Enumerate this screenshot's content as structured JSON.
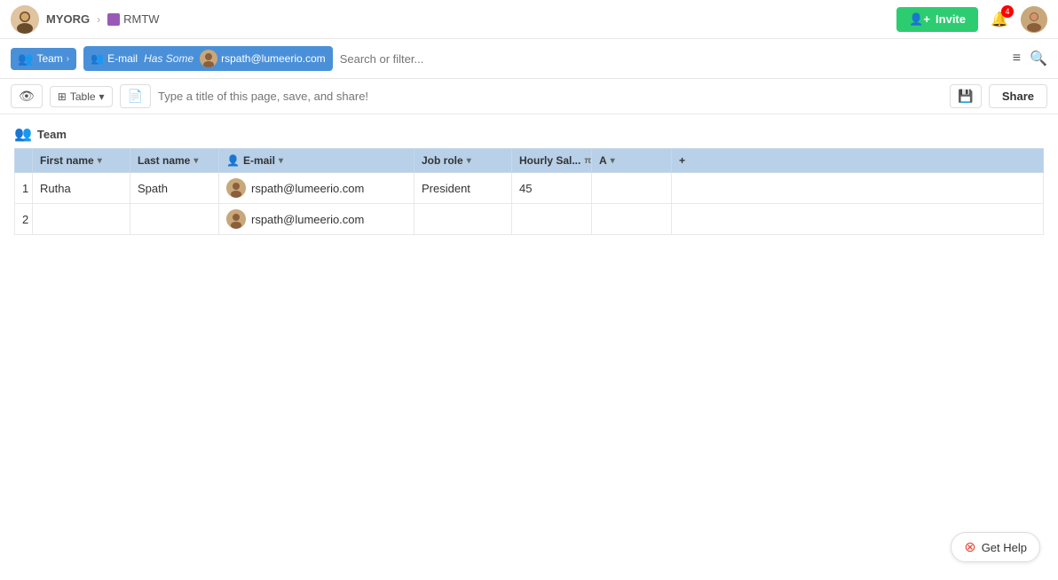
{
  "nav": {
    "org": "MYORG",
    "workspace": "RMTW",
    "invite_label": "Invite",
    "notif_count": "4"
  },
  "filter_bar": {
    "team_label": "Team",
    "email_label": "E-mail",
    "has_some": "Has Some",
    "email_value": "rspath@lumeerio.com",
    "search_placeholder": "Search or filter..."
  },
  "toolbar": {
    "table_label": "Table",
    "page_title_placeholder": "Type a title of this page, save, and share!",
    "share_label": "Share"
  },
  "table": {
    "group_label": "Team",
    "columns": [
      {
        "label": "First name",
        "key": "fn"
      },
      {
        "label": "Last name",
        "key": "ln"
      },
      {
        "label": "E-mail",
        "key": "em"
      },
      {
        "label": "Job role",
        "key": "jr"
      },
      {
        "label": "Hourly Sal...",
        "key": "hs"
      },
      {
        "label": "π",
        "key": "pi"
      },
      {
        "label": "A",
        "key": "a"
      }
    ],
    "rows": [
      {
        "num": "1",
        "first_name": "Rutha",
        "last_name": "Spath",
        "email": "rspath@lumeerio.com",
        "job_role": "President",
        "hourly_sal": "45",
        "a": ""
      },
      {
        "num": "2",
        "first_name": "",
        "last_name": "",
        "email": "rspath@lumeerio.com",
        "job_role": "",
        "hourly_sal": "",
        "a": ""
      }
    ]
  },
  "help": {
    "label": "Get Help"
  }
}
